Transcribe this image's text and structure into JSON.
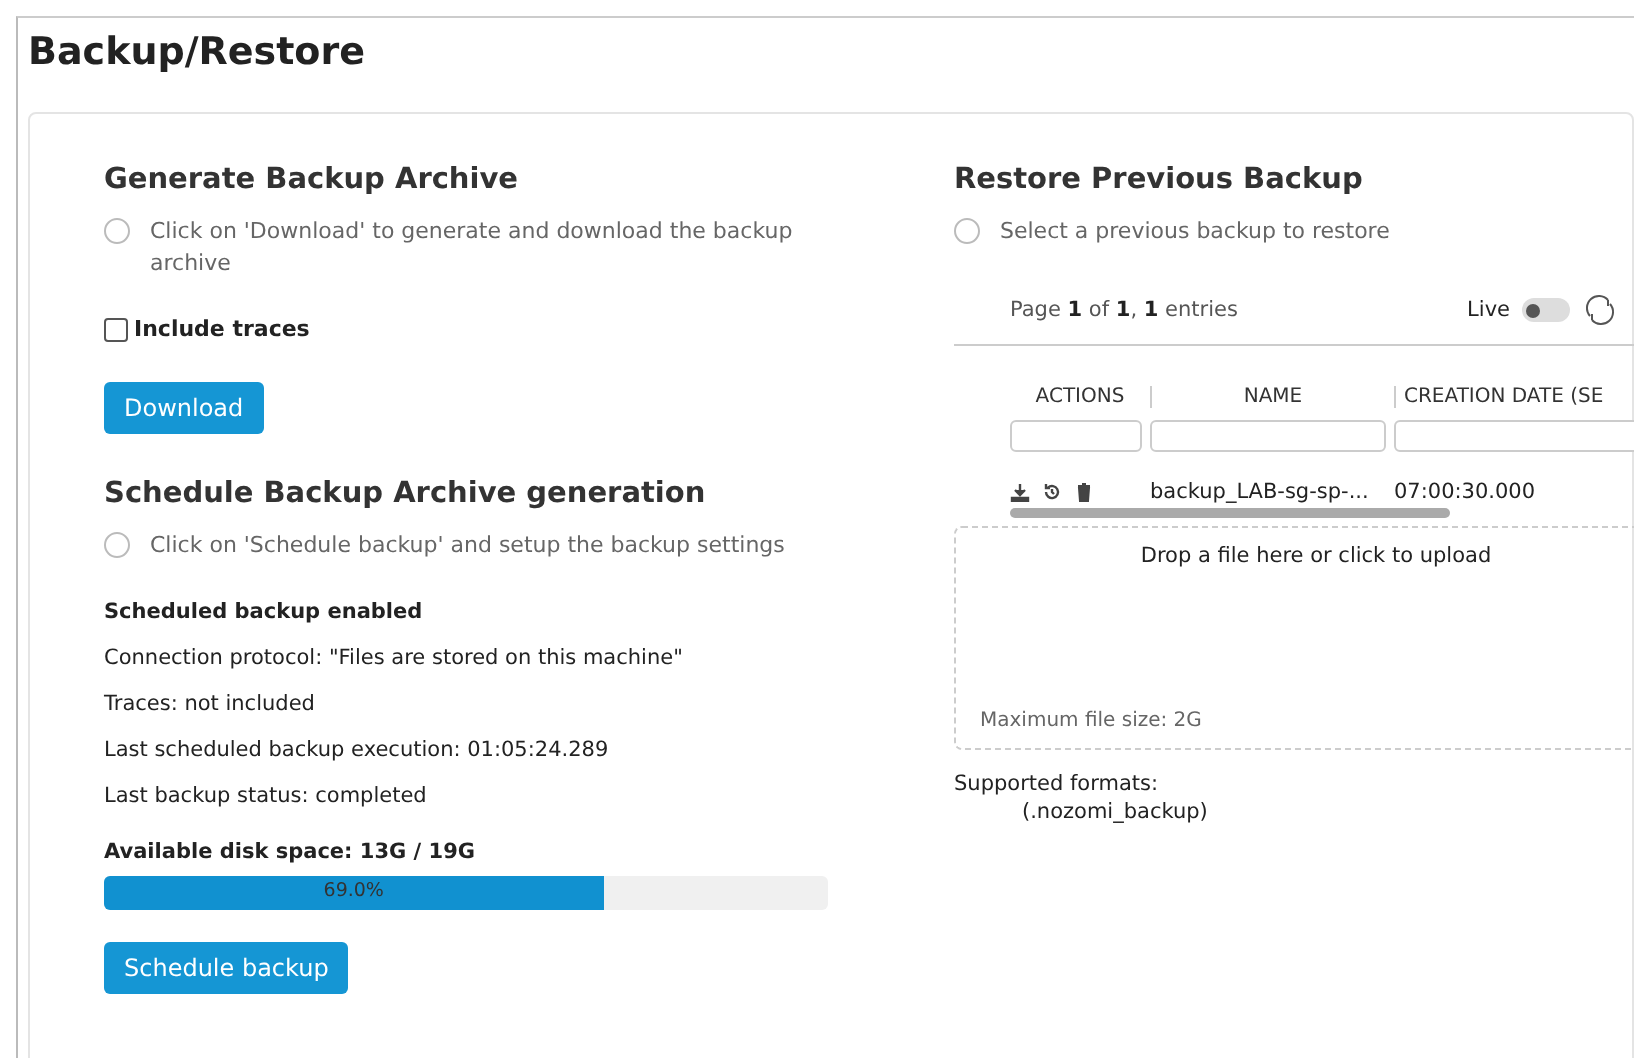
{
  "page_title": "Backup/Restore",
  "generate": {
    "title": "Generate Backup Archive",
    "info": "Click on 'Download' to generate and download the backup archive",
    "include_traces": {
      "label": "Include traces",
      "checked": false
    },
    "button": "Download"
  },
  "schedule": {
    "title": "Schedule Backup Archive generation",
    "info": "Click on 'Schedule backup' and setup the backup settings",
    "status_title": "Scheduled backup enabled",
    "details": [
      "Connection protocol: \"Files are stored on this machine\"",
      "Traces: not included",
      "Last scheduled backup execution: 01:05:24.289",
      "Last backup status: completed"
    ],
    "disk_label": "Available disk space: 13G / 19G",
    "disk": {
      "level": 0.69,
      "reading": "69.0%"
    },
    "button": "Schedule backup"
  },
  "restore": {
    "title": "Restore Previous Backup",
    "info": "Select a previous backup to restore",
    "pagination": "Page **1** of **1**, **1** entries",
    "live": {
      "label": "Live",
      "on": false
    },
    "table": {
      "columns": [
        "ACTIONS",
        "NAME",
        "CREATION DATE (SE"
      ],
      "rows": [
        {
          "name": "backup_LAB-sg-sp-...",
          "created": "07:00:30.000"
        }
      ]
    },
    "upload": {
      "prompt": "Drop a file here or click to upload",
      "max_size": "Maximum file size: 2G"
    },
    "formats_label": "Supported formats:",
    "formats": "(.nozomi_backup)"
  }
}
